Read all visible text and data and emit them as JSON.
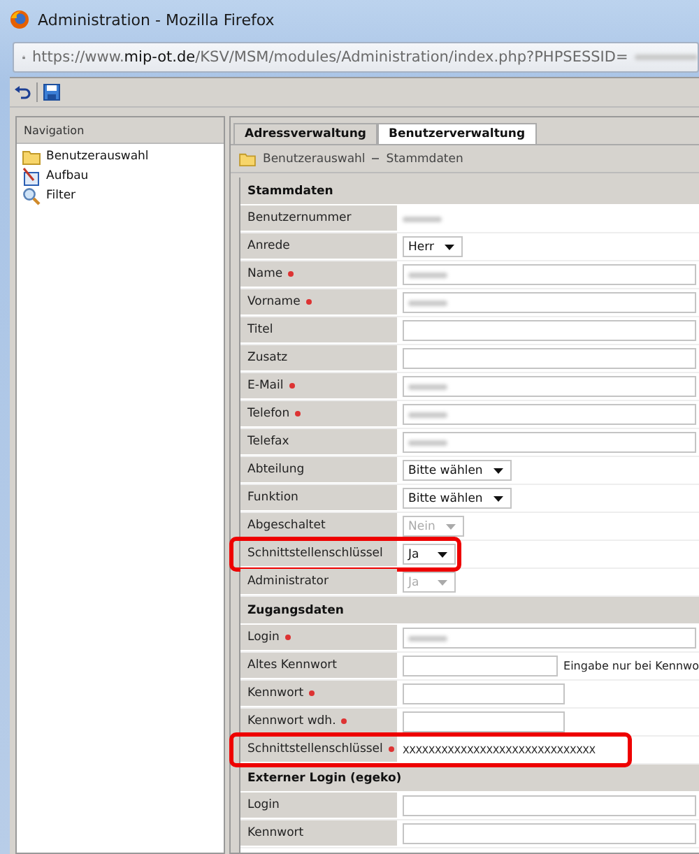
{
  "window": {
    "title": "Administration - Mozilla Firefox"
  },
  "address_bar": {
    "url": "https://www.**mip-ot.de**/KSV/MSM/modules/Administration/index.php?PHPSESSID=",
    "redacted": true
  },
  "navigation": {
    "title": "Navigation",
    "items": [
      {
        "label": "Benutzerauswahl"
      },
      {
        "label": "Aufbau"
      },
      {
        "label": "Filter"
      }
    ]
  },
  "tabs": [
    {
      "label": "Adressverwaltung",
      "selected": false
    },
    {
      "label": "Benutzerverwaltung",
      "selected": true
    }
  ],
  "breadcrumb": [
    "Benutzerauswahl",
    "Stammdaten"
  ],
  "sections": [
    {
      "title": "Stammdaten",
      "rows": [
        {
          "label": "Benutzernummer",
          "kind": "static",
          "redacted": true
        },
        {
          "label": "Anrede",
          "kind": "select",
          "value": "Herr",
          "disabled": false
        },
        {
          "label": "Name",
          "required": true,
          "kind": "input",
          "redacted": true
        },
        {
          "label": "Vorname",
          "required": true,
          "kind": "input",
          "redacted": true
        },
        {
          "label": "Titel",
          "kind": "input"
        },
        {
          "label": "Zusatz",
          "kind": "input"
        },
        {
          "label": "E-Mail",
          "required": true,
          "kind": "input",
          "redacted": true
        },
        {
          "label": "Telefon",
          "required": true,
          "kind": "input",
          "redacted": true
        },
        {
          "label": "Telefax",
          "kind": "input",
          "redacted": true
        },
        {
          "label": "Abteilung",
          "kind": "select",
          "value": "Bitte wählen",
          "disabled": false
        },
        {
          "label": "Funktion",
          "kind": "select",
          "value": "Bitte wählen",
          "disabled": false
        },
        {
          "label": "Abgeschaltet",
          "kind": "select",
          "value": "Nein",
          "disabled": true
        },
        {
          "label": "Schnittstellenschlüssel",
          "kind": "select",
          "value": "Ja",
          "disabled": false,
          "highlighted": true
        },
        {
          "label": "Administrator",
          "kind": "select",
          "value": "Ja",
          "disabled": true
        }
      ]
    },
    {
      "title": "Zugangsdaten",
      "rows": [
        {
          "label": "Login",
          "required": true,
          "kind": "input",
          "redacted": true
        },
        {
          "label": "Altes Kennwort",
          "kind": "short_input",
          "note": "Eingabe nur bei Kennwo"
        },
        {
          "label": "Kennwort",
          "required": true,
          "kind": "short_input"
        },
        {
          "label": "Kennwort wdh.",
          "required": true,
          "kind": "short_input"
        },
        {
          "label": "Schnittstellenschlüssel",
          "required": true,
          "kind": "text",
          "value": "XXXXXXXXXXXXXXXXXXXXXXXXXXXXXX",
          "highlighted": true
        }
      ]
    },
    {
      "title": "Externer Login (egeko)",
      "rows": [
        {
          "label": "Login",
          "kind": "input"
        },
        {
          "label": "Kennwort",
          "kind": "input"
        }
      ]
    }
  ]
}
